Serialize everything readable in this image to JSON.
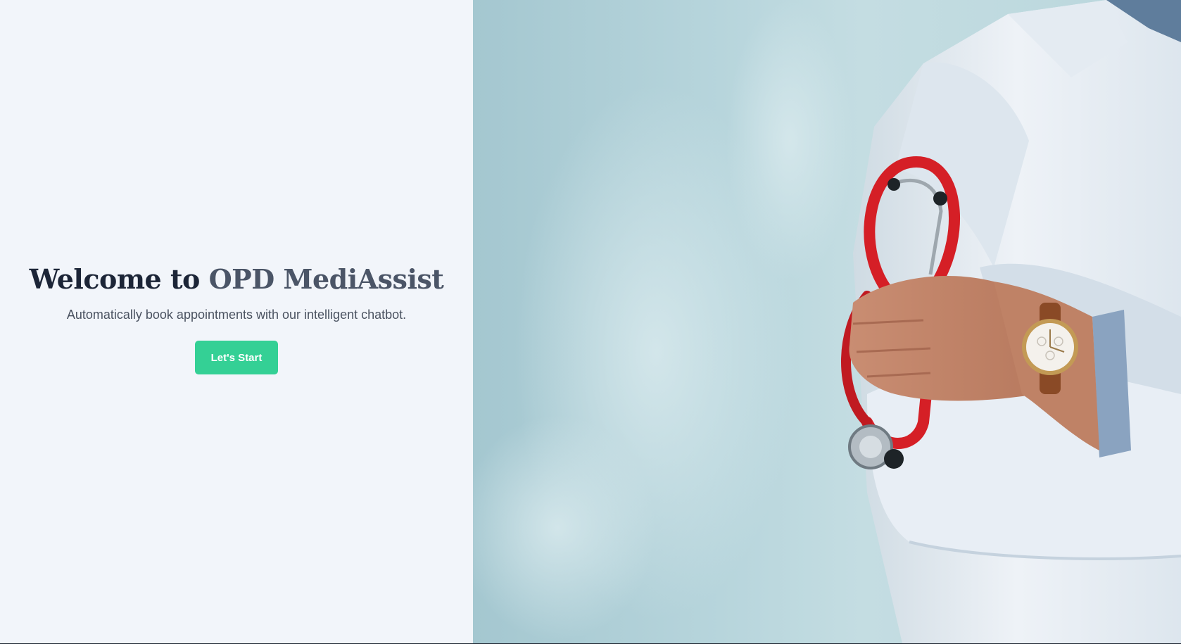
{
  "hero": {
    "title_prefix": "Welcome to ",
    "title_brand": "OPD MediAssist",
    "subtitle": "Automatically book appointments with our intelligent chatbot.",
    "cta_label": "Let's Start"
  },
  "colors": {
    "left_background": "#f2f5fa",
    "title_dark": "#1c2537",
    "title_brand": "#4b5567",
    "cta_background": "#34d095",
    "cta_text": "#ffffff"
  },
  "image": {
    "subject": "doctor in white coat holding red stethoscope"
  }
}
